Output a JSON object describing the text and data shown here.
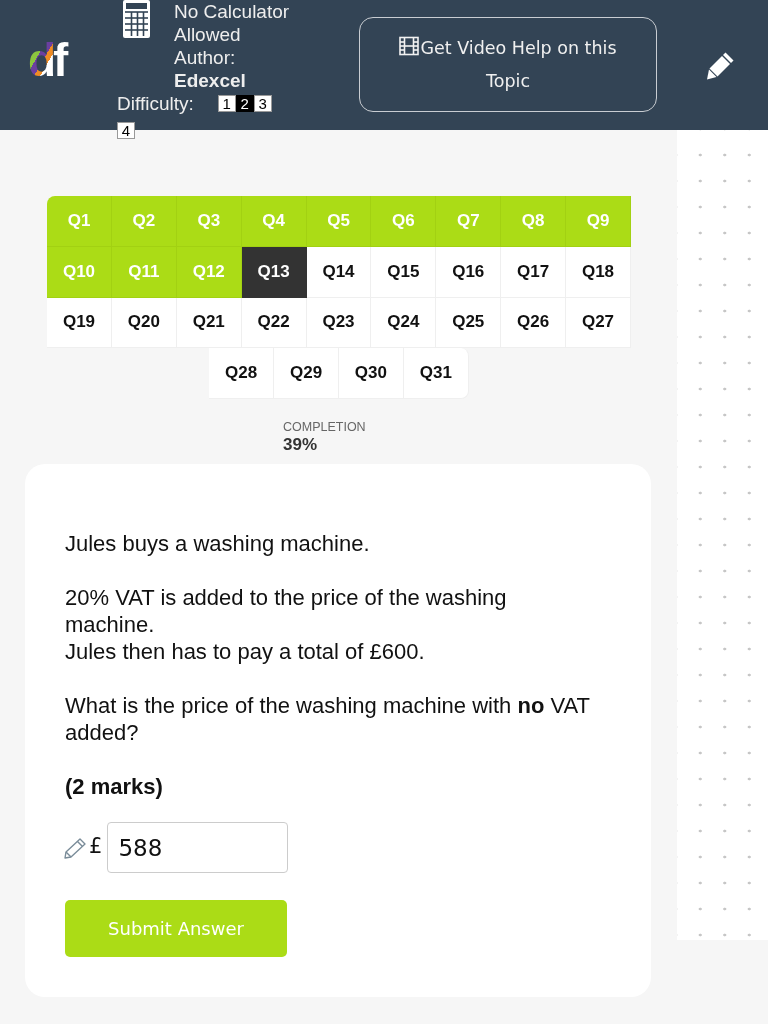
{
  "header": {
    "logo": "df",
    "calculator": "No Calculator Allowed",
    "author_label": "Author:",
    "author": "Edexcel",
    "difficulty": {
      "label": "Difficulty:",
      "levels": [
        {
          "label": "1",
          "selected": false
        },
        {
          "label": "2",
          "selected": true
        },
        {
          "label": "3",
          "selected": false
        },
        {
          "label": "4",
          "selected": false
        }
      ]
    },
    "video_help_button": "Get Video Help on this Topic"
  },
  "questions": [
    {
      "label": "Q1",
      "answered": true,
      "selected": false
    },
    {
      "label": "Q2",
      "answered": true,
      "selected": false
    },
    {
      "label": "Q3",
      "answered": true,
      "selected": false
    },
    {
      "label": "Q4",
      "answered": true,
      "selected": false
    },
    {
      "label": "Q5",
      "answered": true,
      "selected": false
    },
    {
      "label": "Q6",
      "answered": true,
      "selected": false
    },
    {
      "label": "Q7",
      "answered": true,
      "selected": false
    },
    {
      "label": "Q8",
      "answered": true,
      "selected": false
    },
    {
      "label": "Q9",
      "answered": true,
      "selected": false
    },
    {
      "label": "Q10",
      "answered": true,
      "selected": false
    },
    {
      "label": "Q11",
      "answered": true,
      "selected": false
    },
    {
      "label": "Q12",
      "answered": true,
      "selected": false
    },
    {
      "label": "Q13",
      "answered": false,
      "selected": true
    },
    {
      "label": "Q14",
      "answered": false,
      "selected": false
    },
    {
      "label": "Q15",
      "answered": false,
      "selected": false
    },
    {
      "label": "Q16",
      "answered": false,
      "selected": false
    },
    {
      "label": "Q17",
      "answered": false,
      "selected": false
    },
    {
      "label": "Q18",
      "answered": false,
      "selected": false
    },
    {
      "label": "Q19",
      "answered": false,
      "selected": false
    },
    {
      "label": "Q20",
      "answered": false,
      "selected": false
    },
    {
      "label": "Q21",
      "answered": false,
      "selected": false
    },
    {
      "label": "Q22",
      "answered": false,
      "selected": false
    },
    {
      "label": "Q23",
      "answered": false,
      "selected": false
    },
    {
      "label": "Q24",
      "answered": false,
      "selected": false
    },
    {
      "label": "Q25",
      "answered": false,
      "selected": false
    },
    {
      "label": "Q26",
      "answered": false,
      "selected": false
    },
    {
      "label": "Q27",
      "answered": false,
      "selected": false
    },
    {
      "label": "Q28",
      "answered": false,
      "selected": false
    },
    {
      "label": "Q29",
      "answered": false,
      "selected": false
    },
    {
      "label": "Q30",
      "answered": false,
      "selected": false
    },
    {
      "label": "Q31",
      "answered": false,
      "selected": false
    }
  ],
  "completion": {
    "label": "COMPLETION",
    "value": "39%"
  },
  "question": {
    "paragraphs": [
      [
        "Jules buys a washing machine."
      ],
      [
        "20% VAT is added to the price of the washing machine.",
        "Jules then has to pay a total of £600."
      ],
      [
        "What is the price of the washing machine with **no** VAT added?"
      ]
    ],
    "marks": "(2 marks)"
  },
  "answer": {
    "prefix": "£",
    "value": "588"
  },
  "submit_button": "Submit Answer"
}
